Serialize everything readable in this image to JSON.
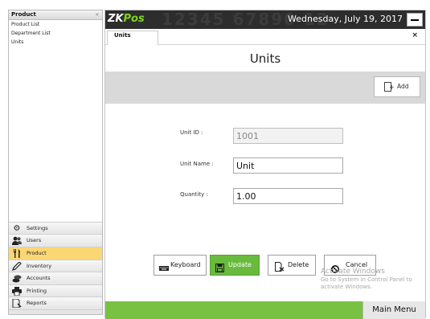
{
  "sidebar": {
    "title": "Product",
    "collapse_glyph": "«",
    "sub_items": [
      "Product List",
      "Department List",
      "Units"
    ],
    "modules": [
      {
        "label": "Settings",
        "icon": "gear-icon",
        "active": false
      },
      {
        "label": "Users",
        "icon": "users-icon",
        "active": false
      },
      {
        "label": "Product",
        "icon": "fork-knife-icon",
        "active": true
      },
      {
        "label": "Inventory",
        "icon": "pencil-icon",
        "active": false
      },
      {
        "label": "Accounts",
        "icon": "coins-icon",
        "active": false
      },
      {
        "label": "Printing",
        "icon": "printer-icon",
        "active": false
      },
      {
        "label": "Reports",
        "icon": "report-icon",
        "active": false
      }
    ]
  },
  "header": {
    "logo_prefix": "ZK",
    "logo_suffix": "Pos",
    "datetime": "Wednesday, July 19, 2017",
    "watermark": "12345 67890 12"
  },
  "tab": {
    "label": "Units",
    "close_glyph": "×"
  },
  "page": {
    "title": "Units",
    "add_label": "Add"
  },
  "form": {
    "unit_id_label": "Unit ID :",
    "unit_id_value": "1001",
    "unit_name_label": "Unit Name :",
    "unit_name_value": "Unit",
    "quantity_label": "Quantity :",
    "quantity_value": "1.00"
  },
  "buttons": {
    "keyboard": "Keyboard",
    "update": "Update",
    "delete": "Delete",
    "cancel": "Cancel"
  },
  "activation": {
    "line1": "Activate Windows",
    "line2": "Go to System in Control Panel to",
    "line3": "activate Windows."
  },
  "footer": {
    "main_menu": "Main Menu"
  },
  "colors": {
    "accent_green": "#79c142",
    "update_green": "#69bb3d",
    "active_module": "#fbd774",
    "topbar": "#2d2d2d"
  }
}
